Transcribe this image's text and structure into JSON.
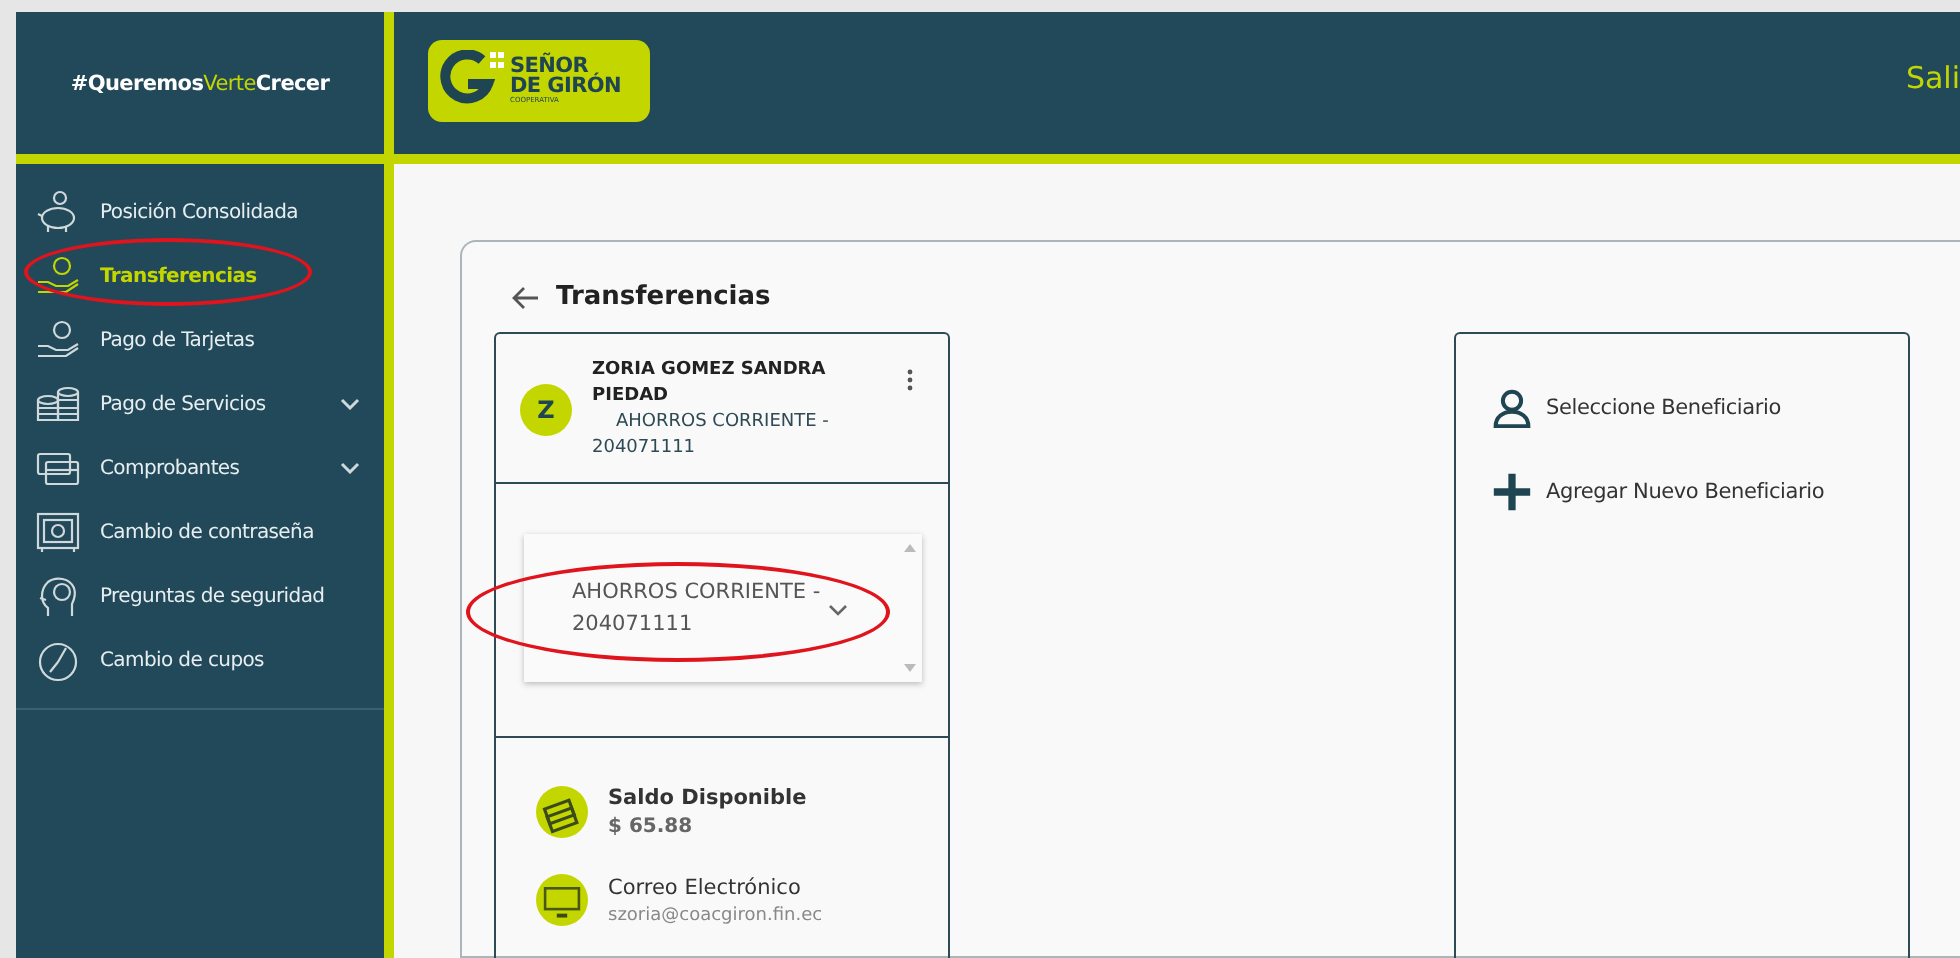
{
  "tagline": [
    {
      "text": "#Queremos",
      "highlight": false
    },
    {
      "text": "Verte",
      "highlight": true
    },
    {
      "text": "Crecer",
      "highlight": false
    }
  ],
  "logo": {
    "line1": "SEÑOR",
    "line2": "DE GIRÓN",
    "line3": "COOPERATIVA"
  },
  "header": {
    "logout": "Sali"
  },
  "sidebar": {
    "items": [
      {
        "label": "Posición Consolidada",
        "selected": false,
        "expandable": false,
        "circled": false
      },
      {
        "label": "Transferencias",
        "selected": true,
        "expandable": false,
        "circled": true
      },
      {
        "label": "Pago de Tarjetas",
        "selected": false,
        "expandable": false,
        "circled": false
      },
      {
        "label": "Pago de Servicios",
        "selected": false,
        "expandable": true,
        "circled": false
      },
      {
        "label": "Comprobantes",
        "selected": false,
        "expandable": true,
        "circled": false
      },
      {
        "label": "Cambio de contraseña",
        "selected": false,
        "expandable": false,
        "circled": false
      },
      {
        "label": "Preguntas de seguridad",
        "selected": false,
        "expandable": false,
        "circled": false
      },
      {
        "label": "Cambio de cupos",
        "selected": false,
        "expandable": false,
        "circled": false
      }
    ]
  },
  "page": {
    "title": "Transferencias"
  },
  "origin": {
    "avatar": "Z",
    "name": "ZORIA GOMEZ SANDRA PIEDAD",
    "account": "AHORROS CORRIENTE - 204071111",
    "dropdown": {
      "value": "AHORROS CORRIENTE - 204071111",
      "circled": true
    },
    "details": [
      {
        "kind": "balance",
        "label": "Saldo Disponible",
        "value": "$ 65.88"
      },
      {
        "kind": "email",
        "label": "Correo Electrónico",
        "value": "szoria@coacgiron.fin.ec"
      }
    ]
  },
  "beneficiary": {
    "actions": [
      {
        "kind": "select",
        "label": "Seleccione Beneficiario"
      },
      {
        "kind": "add",
        "label": "Agregar Nuevo Beneficiario"
      }
    ]
  }
}
